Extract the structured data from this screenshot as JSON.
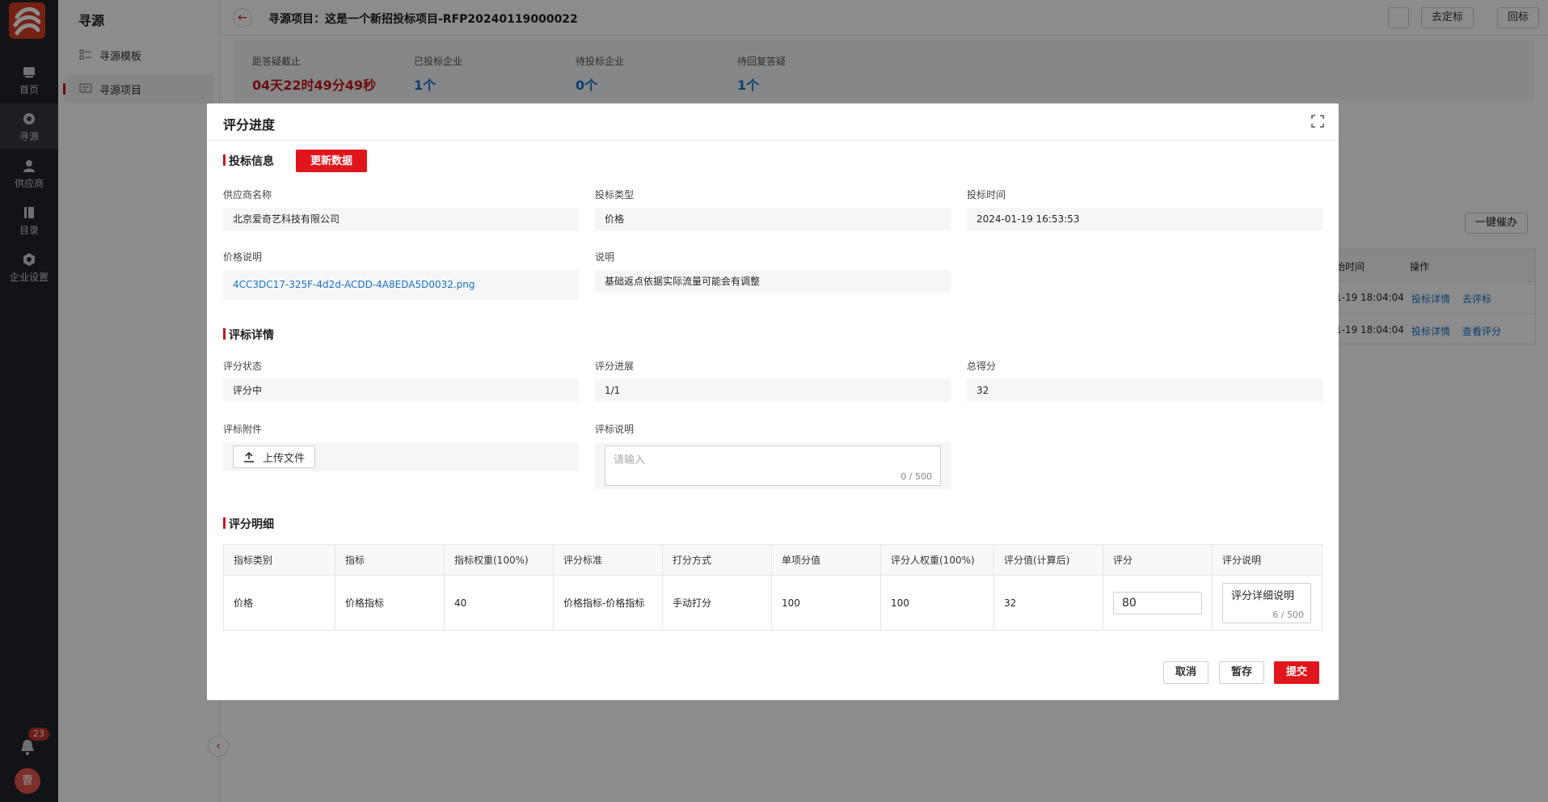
{
  "rail": {
    "items": [
      {
        "label": "首页",
        "icon": "home-icon"
      },
      {
        "label": "寻源",
        "icon": "sourcing-icon"
      },
      {
        "label": "供应商",
        "icon": "supplier-icon"
      },
      {
        "label": "目录",
        "icon": "catalog-icon"
      },
      {
        "label": "企业设置",
        "icon": "settings-icon"
      }
    ],
    "notification_count": "23",
    "avatar_text": "曹"
  },
  "subnav": {
    "title": "寻源",
    "items": [
      {
        "label": "寻源模板"
      },
      {
        "label": "寻源项目"
      }
    ]
  },
  "header": {
    "title": "寻源项目：这是一个新招投标项目-RFP20240119000022",
    "buttons": {
      "award": "去定标",
      "return": "回标"
    }
  },
  "stats": [
    {
      "label": "距答疑截止",
      "value": "04天22时49分49秒"
    },
    {
      "label": "已投标企业",
      "value": "1个"
    },
    {
      "label": "待投标企业",
      "value": "0个"
    },
    {
      "label": "待回复答疑",
      "value": "1个"
    }
  ],
  "background": {
    "remind_button": "一键催办",
    "table_headers": [
      "始时间",
      "操作"
    ],
    "rows": [
      {
        "time": "1-19 18:04:04",
        "action1": "投标详情",
        "action2": "去评标"
      },
      {
        "time": "1-19 18:04:04",
        "action1": "投标详情",
        "action2": "查看评分"
      }
    ]
  },
  "modal": {
    "title": "评分进度",
    "bid_info": {
      "section_title": "投标信息",
      "refresh_button": "更新数据",
      "supplier_label": "供应商名称",
      "supplier_value": "北京爱奇艺科技有限公司",
      "bid_type_label": "投标类型",
      "bid_type_value": "价格",
      "bid_time_label": "投标时间",
      "bid_time_value": "2024-01-19 16:53:53",
      "price_desc_label": "价格说明",
      "price_desc_value": "4CC3DC17-325F-4d2d-ACDD-4A8EDA5D0032.png",
      "remark_label": "说明",
      "remark_value": "基础返点依据实际流量可能会有调整"
    },
    "eval_detail": {
      "section_title": "评标详情",
      "status_label": "评分状态",
      "status_value": "评分中",
      "progress_label": "评分进展",
      "progress_value": "1/1",
      "total_label": "总得分",
      "total_value": "32",
      "attachment_label": "评标附件",
      "upload_button": "上传文件",
      "desc_label": "评标说明",
      "desc_placeholder": "请输入",
      "desc_counter": "0 / 500"
    },
    "score_detail": {
      "section_title": "评分明细",
      "headers": [
        "指标类别",
        "指标",
        "指标权重(100%)",
        "评分标准",
        "打分方式",
        "单项分值",
        "评分人权重(100%)",
        "评分值(计算后)",
        "评分",
        "评分说明"
      ],
      "row": {
        "category": "价格",
        "indicator": "价格指标",
        "weight": "40",
        "standard": "价格指标-价格指标",
        "method": "手动打分",
        "item_score": "100",
        "rater_weight": "100",
        "computed": "32",
        "score_input": "80",
        "remark_text": "评分详细说明",
        "remark_counter": "6 / 500"
      }
    },
    "footer": {
      "cancel": "取消",
      "save": "暂存",
      "submit": "提交"
    }
  },
  "colors": {
    "brand_red": "#e1161d",
    "link_blue": "#1a73c8",
    "rail_bg": "#1f2328"
  }
}
